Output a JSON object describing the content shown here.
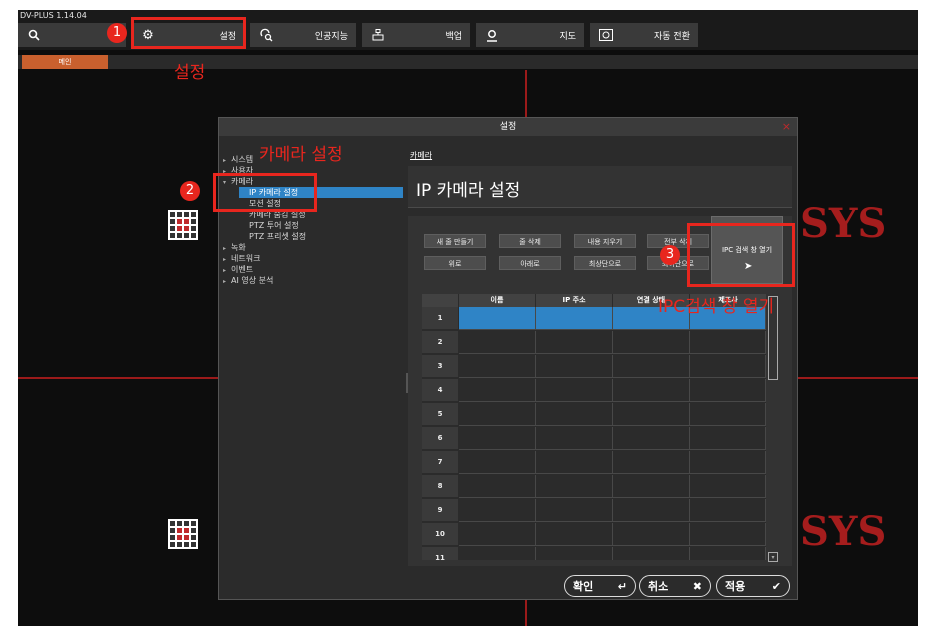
{
  "app": {
    "version": "DV-PLUS 1.14.04"
  },
  "toolbar": {
    "search_label": "",
    "settings_label": "설정",
    "ai_label": "인공지능",
    "backup_label": "백업",
    "map_label": "지도",
    "auto_switch_label": "자동 전환"
  },
  "tabs": {
    "main_label": "메인"
  },
  "background": {
    "logo_text": "SYS"
  },
  "dialog": {
    "title": "설정",
    "close": "×",
    "breadcrumb": "카메라",
    "page_title": "IP 카메라 설정",
    "tree": [
      {
        "label": "시스템",
        "arrow": "▸"
      },
      {
        "label": "사용자",
        "arrow": "▸"
      },
      {
        "label": "카메라",
        "arrow": "▾"
      },
      {
        "label": "IP 카메라 설정",
        "arrow": ""
      },
      {
        "label": "모션 설정",
        "arrow": ""
      },
      {
        "label": "카메라 숨김 설정",
        "arrow": ""
      },
      {
        "label": "PTZ 투어 설정",
        "arrow": ""
      },
      {
        "label": "PTZ 프리셋 설정",
        "arrow": ""
      },
      {
        "label": "녹화",
        "arrow": "▸"
      },
      {
        "label": "네트워크",
        "arrow": "▸"
      },
      {
        "label": "이벤트",
        "arrow": "▸"
      },
      {
        "label": "AI 영상 분석",
        "arrow": "▸"
      }
    ],
    "buttons": {
      "new_row": "새 줄 만들기",
      "delete_row": "줄 삭제",
      "clear_content": "내용 지우기",
      "delete_all": "전부 삭제",
      "up": "위로",
      "down": "아래로",
      "top": "최상단으로",
      "bottom": "최하단으로",
      "ipc_search": "IPC 검색 창 열기"
    },
    "table": {
      "headers": [
        "이름",
        "IP 주소",
        "연결 상태",
        "제조사"
      ],
      "rows": [
        "1",
        "2",
        "3",
        "4",
        "5",
        "6",
        "7",
        "8",
        "9",
        "10",
        "11"
      ]
    },
    "footer": {
      "confirm": "확인",
      "confirm_icon": "↵",
      "cancel": "취소",
      "cancel_icon": "✖",
      "apply": "적용",
      "apply_icon": "✔"
    }
  },
  "annotations": {
    "step1_num": "1",
    "step1_text": "설정",
    "step2_num": "2",
    "step2_text": "카메라 설정",
    "step3_num": "3",
    "step3_text": "IPC검색 창 열기",
    "color": "#e8261e"
  },
  "colors": {
    "accent_blue": "#2f84c6",
    "tab_orange": "#c9602e",
    "divider_red": "#9b1a1a"
  }
}
